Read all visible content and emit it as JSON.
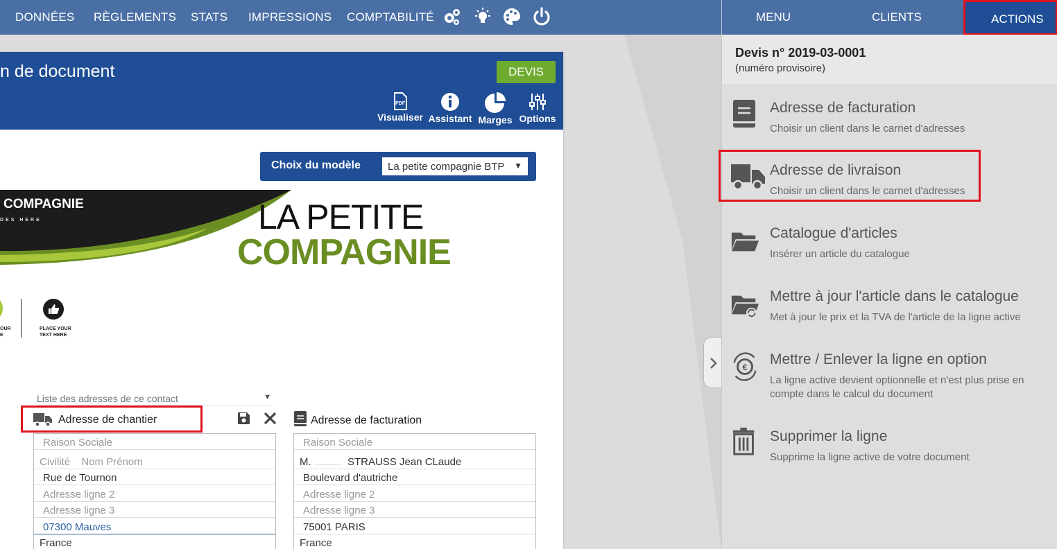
{
  "topnav": {
    "items": [
      "DONNÉES",
      "RÈGLEMENTS",
      "STATS",
      "IMPRESSIONS",
      "COMPTABILITÉ"
    ],
    "icons": [
      "gears-icon",
      "lightbulb-icon",
      "palette-icon",
      "power-icon"
    ]
  },
  "document": {
    "title": "n de document",
    "devis_label": "DEVIS",
    "tools": [
      {
        "label": "Visualiser",
        "icon": "pdf-icon"
      },
      {
        "label": "Assistant",
        "icon": "info-icon"
      },
      {
        "label": "Marges",
        "icon": "pie-chart-icon"
      },
      {
        "label": "Options",
        "icon": "sliders-icon"
      }
    ],
    "model": {
      "label": "Choix du modèle",
      "selected": "La petite compagnie BTP"
    },
    "banner": {
      "company_small": "COMPAGNIE",
      "tagline_small": "DES HERE",
      "big_line1": "LA PETITE",
      "big_line2": "COMPAGNIE",
      "place_text_left": "OUR\nE",
      "place_text_right": "PLACE YOUR\nTEXT HERE"
    },
    "address_list_placeholder": "Liste des adresses de ce contact",
    "chantier": {
      "header": "Adresse de chantier",
      "raison_sociale": "Raison Sociale",
      "civilite": "Civilité",
      "nom_prenom": "Nom Prénom",
      "line1": "Rue de Tournon",
      "line2": "Adresse ligne 2",
      "line3": "Adresse ligne 3",
      "city": "07300 Mauves",
      "country": "France"
    },
    "facturation": {
      "header": "Adresse de facturation",
      "raison_sociale": "Raison Sociale",
      "civilite": "M.",
      "nom_prenom": "STRAUSS Jean CLaude",
      "line1": "Boulevard d'autriche",
      "line2": "Adresse ligne 2",
      "line3": "Adresse ligne 3",
      "city": "75001 PARIS",
      "country": "France"
    }
  },
  "panel": {
    "tabs": [
      "MENU",
      "CLIENTS",
      "ACTIONS"
    ],
    "active_tab": "ACTIONS",
    "doc_number": "Devis n° 2019-03-0001",
    "doc_status": "(numéro provisoire)",
    "actions": [
      {
        "title": "Adresse de facturation",
        "desc": "Choisir un client dans le carnet d'adresses",
        "icon": "address-book-icon"
      },
      {
        "title": "Adresse de livraison",
        "desc": "Choisir un client dans le carnet d'adresses",
        "icon": "truck-icon"
      },
      {
        "title": "Catalogue d'articles",
        "desc": "Insérer un article du catalogue",
        "icon": "folder-open-icon"
      },
      {
        "title": "Mettre à jour l'article dans le catalogue",
        "desc": "Met à jour le prix et la TVA de l'article de la ligne active",
        "icon": "folder-sync-icon"
      },
      {
        "title": "Mettre / Enlever la ligne en option",
        "desc": "La ligne active devient optionnelle et n'est plus prise en compte dans le calcul du document",
        "icon": "euro-cycle-icon"
      },
      {
        "title": "Supprimer la ligne",
        "desc": "Supprime la ligne active de votre document",
        "icon": "trash-icon"
      }
    ]
  },
  "colors": {
    "nav": "#4a6fa5",
    "header": "#1f4e96",
    "accent_green": "#6eab2f",
    "highlight": "#e0141e"
  }
}
